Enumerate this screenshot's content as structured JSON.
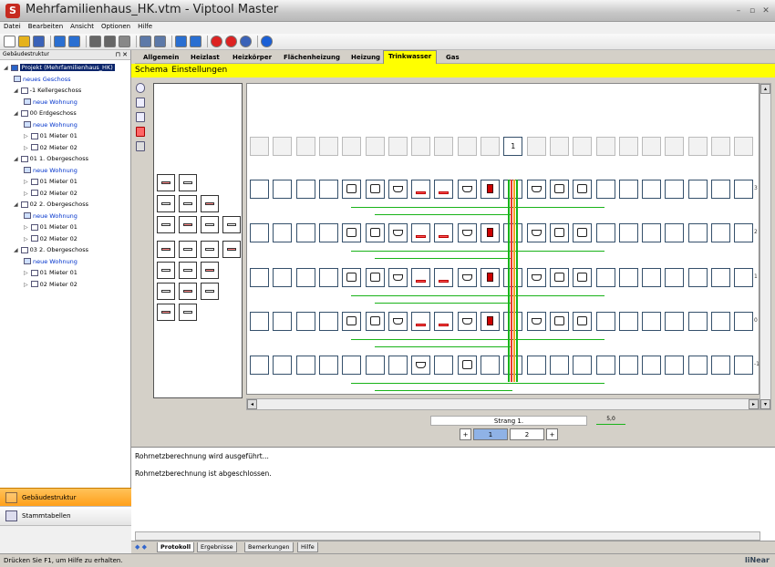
{
  "window": {
    "title": "Mehrfamilienhaus_HK.vtm - Viptool Master",
    "logo": "S",
    "minimize": "–",
    "restore": "▫",
    "close": "✕"
  },
  "menu": [
    "Datei",
    "Bearbeiten",
    "Ansicht",
    "Optionen",
    "Hilfe"
  ],
  "toolbar_icons": [
    "new-icon",
    "open-icon",
    "save-icon",
    "undo-icon",
    "redo-icon",
    "cut-icon",
    "copy-icon",
    "paste-icon",
    "print-icon",
    "print-preview-icon",
    "import-icon",
    "export-icon",
    "calc-icon",
    "calc-all-icon",
    "settings-icon",
    "info-icon"
  ],
  "leftpanel": {
    "title": "Gebäudestruktur",
    "tree": [
      {
        "label": "Projekt (Mehrfamilienhaus_HK)",
        "indent": 0,
        "type": "project",
        "selected": true
      },
      {
        "label": "neues Geschoss",
        "indent": 1,
        "type": "add"
      },
      {
        "label": "-1 Kellergeschoss",
        "indent": 1,
        "type": "floor"
      },
      {
        "label": "neue Wohnung",
        "indent": 2,
        "type": "add"
      },
      {
        "label": "00 Erdgeschoss",
        "indent": 1,
        "type": "floor"
      },
      {
        "label": "neue Wohnung",
        "indent": 2,
        "type": "add"
      },
      {
        "label": "01 Mieter 01",
        "indent": 2,
        "type": "unit"
      },
      {
        "label": "02 Mieter 02",
        "indent": 2,
        "type": "unit"
      },
      {
        "label": "01 1. Obergeschoss",
        "indent": 1,
        "type": "floor"
      },
      {
        "label": "neue Wohnung",
        "indent": 2,
        "type": "add"
      },
      {
        "label": "01 Mieter 01",
        "indent": 2,
        "type": "unit"
      },
      {
        "label": "02 Mieter 02",
        "indent": 2,
        "type": "unit"
      },
      {
        "label": "02 2. Obergeschoss",
        "indent": 1,
        "type": "floor"
      },
      {
        "label": "neue Wohnung",
        "indent": 2,
        "type": "add"
      },
      {
        "label": "01 Mieter 01",
        "indent": 2,
        "type": "unit"
      },
      {
        "label": "02 Mieter 02",
        "indent": 2,
        "type": "unit"
      },
      {
        "label": "03 2. Obergeschoss",
        "indent": 1,
        "type": "floor"
      },
      {
        "label": "neue Wohnung",
        "indent": 2,
        "type": "add"
      },
      {
        "label": "01 Mieter 01",
        "indent": 2,
        "type": "unit"
      },
      {
        "label": "02 Mieter 02",
        "indent": 2,
        "type": "unit"
      }
    ],
    "buttons": {
      "gebaeude": "Gebäudestruktur",
      "stamm": "Stammtabellen"
    }
  },
  "tabs": [
    "Allgemein",
    "Heizlast",
    "Heizkörper",
    "Flächenheizung",
    "Heizung",
    "Trinkwasser",
    "Gas"
  ],
  "active_tab": "Trinkwasser",
  "subtabs": [
    "Schema",
    "Einstellungen"
  ],
  "schema": {
    "strang_number": "1",
    "level_labels": [
      "3",
      "2",
      "1",
      "0",
      "-1"
    ],
    "strang_label": "Strang 1.",
    "strang_value": "5,0",
    "pages": [
      "1",
      "2"
    ],
    "page_prev": "+",
    "page_next": "+"
  },
  "output": {
    "lines": [
      "Rohrnetzberechnung wird ausgeführt...",
      "Rohrnetzberechnung ist abgeschlossen."
    ]
  },
  "bottomtabs": [
    "Protokoll",
    "Ergebnisse",
    "Bemerkungen",
    "Hilfe"
  ],
  "active_bottomtab": "Protokoll",
  "status": "Drücken Sie F1, um Hilfe zu erhalten.",
  "brand": "liNear"
}
